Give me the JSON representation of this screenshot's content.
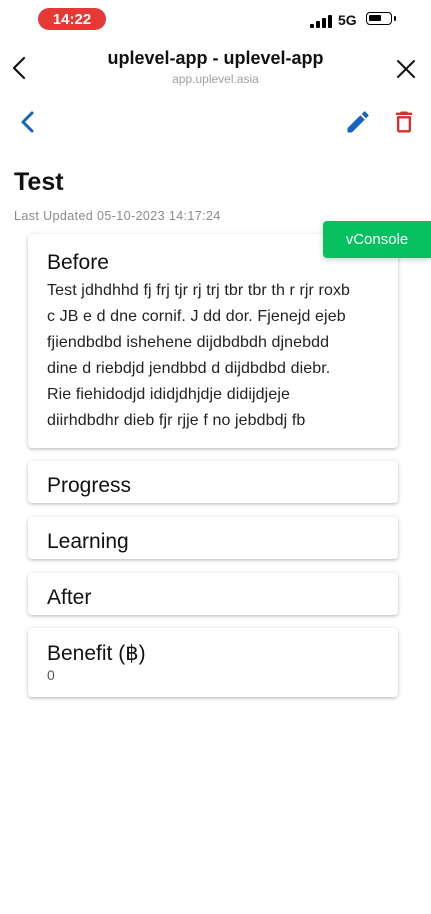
{
  "status_bar": {
    "time": "14:22",
    "network": "5G"
  },
  "browser": {
    "title": "uplevel-app - uplevel-app",
    "url": "app.uplevel.asia"
  },
  "page": {
    "title": "Test",
    "last_updated": "Last Updated 05-10-2023 14:17:24"
  },
  "sections": {
    "before": {
      "title": "Before",
      "lines": [
        "Test jdhdhhd fj frj tjr rj trj tbr tbr th r rjr roxb",
        "c JB e d dne cornif. J dd dor. Fjenejd ejeb",
        "fjiendbdbd ishehene dijdbdbdh djnebdd",
        "dine d riebdjd jendbbd d dijdbdbd diebr.",
        "Rie fiehidodjd ididjdhjdje didijdjeje",
        "diirhdbdhr dieb fjr rjje f no jebdbdj fb"
      ]
    },
    "progress": {
      "title": "Progress"
    },
    "learning": {
      "title": "Learning"
    },
    "after": {
      "title": "After"
    },
    "benefit": {
      "title": "Benefit (฿)",
      "value": "0"
    }
  },
  "vconsole": {
    "label": "vConsole"
  },
  "colors": {
    "accent": "#1565c0",
    "delete": "#d32f2f",
    "vconsole": "#07c160",
    "time_pill": "#e53935"
  },
  "icons": {
    "browser_back": "chevron-left-icon",
    "browser_close": "close-icon",
    "app_back": "chevron-left-icon",
    "edit": "pencil-icon",
    "delete": "trash-icon"
  }
}
